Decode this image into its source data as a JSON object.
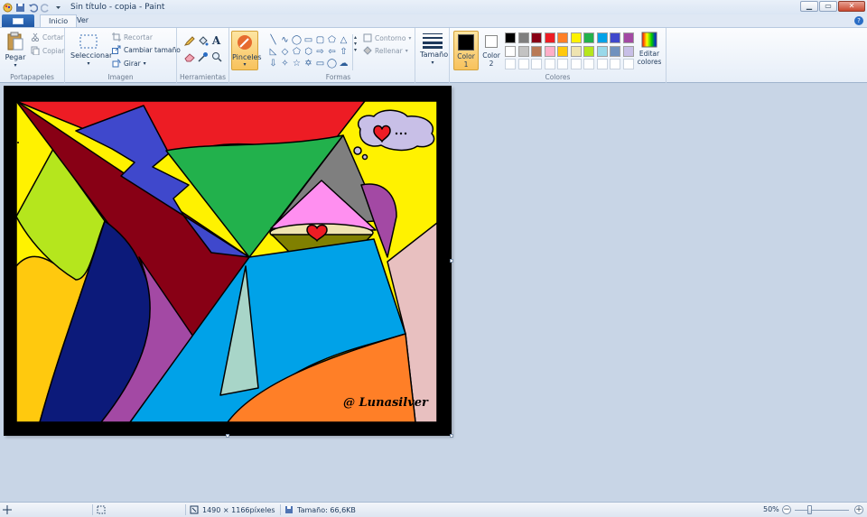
{
  "window": {
    "title": "Sin título - copia - Paint",
    "minimize_icon": "minimize-icon",
    "maximize_icon": "maximize-icon",
    "close_icon": "close-icon"
  },
  "tabs": [
    {
      "label": "Inicio",
      "active": true
    },
    {
      "label": "Ver",
      "active": false
    }
  ],
  "ribbon": {
    "clipboard": {
      "group_label": "Portapapeles",
      "paste": "Pegar",
      "cut": "Cortar",
      "copy": "Copiar"
    },
    "image": {
      "group_label": "Imagen",
      "select": "Seleccionar",
      "crop": "Recortar",
      "resize": "Cambiar tamaño",
      "rotate": "Girar"
    },
    "tools": {
      "group_label": "Herramientas"
    },
    "brushes": {
      "label": "Pinceles"
    },
    "shapes": {
      "group_label": "Formas",
      "outline": "Contorno",
      "fill": "Rellenar"
    },
    "size": {
      "label": "Tamaño"
    },
    "colors": {
      "group_label": "Colores",
      "color1": "Color\n1",
      "color1_a": "Color",
      "color1_b": "1",
      "color2_a": "Color",
      "color2_b": "2",
      "edit_a": "Editar",
      "edit_b": "colores",
      "color1_value": "#000000",
      "color2_value": "#ffffff",
      "palette": [
        "#000000",
        "#7f7f7f",
        "#880015",
        "#ed1c24",
        "#ff7f27",
        "#fff200",
        "#22b14c",
        "#00a2e8",
        "#3f48cc",
        "#a349a4",
        "#ffffff",
        "#c3c3c3",
        "#b97a57",
        "#ffaec9",
        "#ffc90e",
        "#efe4b0",
        "#b5e61d",
        "#99d9ea",
        "#7092be",
        "#c8bfe7",
        "#ffffff",
        "#ffffff",
        "#ffffff",
        "#ffffff",
        "#ffffff",
        "#ffffff",
        "#ffffff",
        "#ffffff",
        "#ffffff",
        "#ffffff"
      ]
    }
  },
  "canvas": {
    "signature": "@ Lunasilver"
  },
  "statusbar": {
    "dimensions": "1490 × 1166píxeles",
    "size": "Tamaño: 66,6KB",
    "zoom": "50%"
  }
}
